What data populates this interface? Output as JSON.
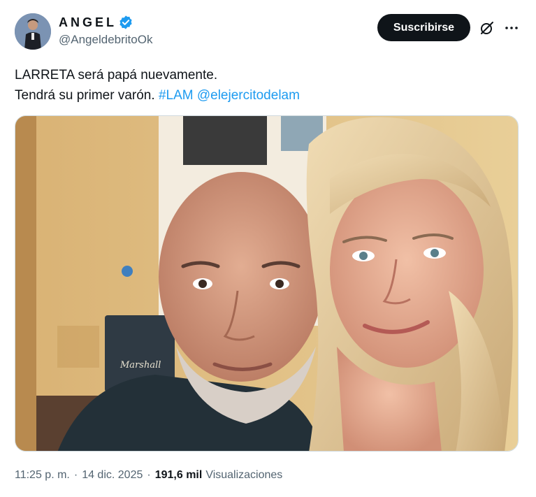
{
  "author": {
    "display_name": "ANGEL",
    "handle": "@AngeldebritoOk",
    "verified": true,
    "avatar_icon": "profile-photo"
  },
  "actions": {
    "subscribe_label": "Suscribirse",
    "grok_icon": "grok-icon",
    "more_icon": "more-icon"
  },
  "tweet": {
    "line1": "LARRETA será papá nuevamente.",
    "line2_text": "Tendrá su primer varón.",
    "hashtag": "#LAM",
    "mention": "@elejercitodelam"
  },
  "media": {
    "amp_brand": "Marshall"
  },
  "footer": {
    "time": "11:25 p. m.",
    "date": "14 dic. 2025",
    "views_count": "191,6 mil",
    "views_label": "Visualizaciones",
    "separator": "·"
  },
  "colors": {
    "accent": "#1d9bf0",
    "text": "#0f1419",
    "muted": "#536471",
    "button_bg": "#0f1419"
  }
}
